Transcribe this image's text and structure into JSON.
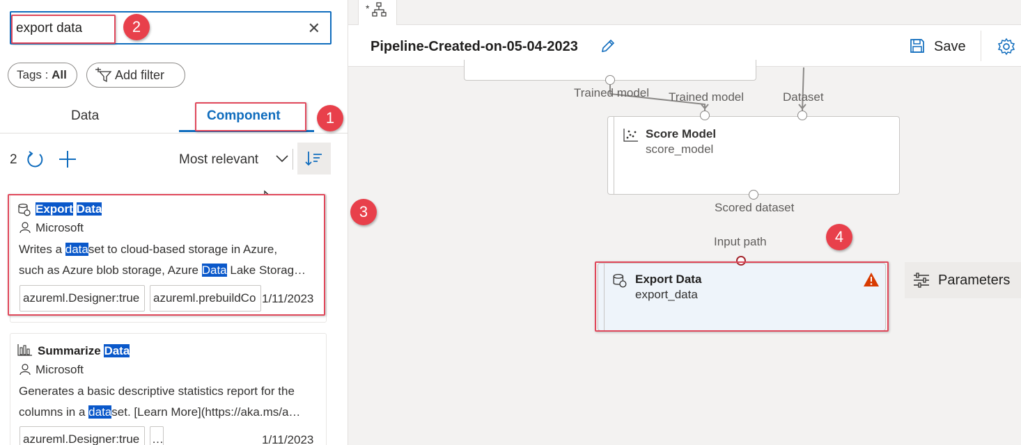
{
  "search": {
    "value": "export data"
  },
  "filters": {
    "tags_label": "Tags : ",
    "tags_value": "All",
    "add_filter": "Add filter"
  },
  "tabs": [
    {
      "label": "Data"
    },
    {
      "label": "Component"
    }
  ],
  "list_toolbar": {
    "count": "2",
    "sort": "Most relevant"
  },
  "results": [
    {
      "title_parts": [
        "Export",
        "Data"
      ],
      "author": "Microsoft",
      "desc_line1_a": "Writes a ",
      "desc_line1_hl": "data",
      "desc_line1_b": "set to cloud-based storage in Azure,",
      "desc_line2_a": "such as Azure blob storage, Azure ",
      "desc_line2_hl": "Data",
      "desc_line2_b": " Lake Storag…",
      "tags": [
        "azureml.Designer:true",
        "azureml.prebuildCo"
      ],
      "date": "1/11/2023"
    },
    {
      "title_a": "Summarize ",
      "title_hl": "Data",
      "author": "Microsoft",
      "desc_line1": "Generates a basic descriptive statistics report for the",
      "desc_line2_a": "columns in a ",
      "desc_line2_hl": "data",
      "desc_line2_b": "set. [Learn More](https://aka.ms/a…",
      "tags": [
        "azureml.Designer:true",
        "…"
      ],
      "date": "1/11/2023"
    }
  ],
  "callouts": [
    "1",
    "2",
    "3",
    "4"
  ],
  "canvas": {
    "doc_tab": "*",
    "pipeline_title": "Pipeline-Created-on-05-04-2023",
    "save": "Save",
    "ports": {
      "trained_model_out": "Trained model",
      "trained_model_in": "Trained model",
      "dataset": "Dataset",
      "scored_dataset": "Scored dataset",
      "input_path": "Input path"
    },
    "score_node": {
      "title": "Score Model",
      "sub": "score_model"
    },
    "export_node": {
      "title": "Export Data",
      "sub": "export_data"
    },
    "parameters": "Parameters"
  },
  "colors": {
    "accent": "#0f6cbd",
    "callout": "#e8404b",
    "highlight": "#0a58ca",
    "warning": "#d83b01"
  }
}
